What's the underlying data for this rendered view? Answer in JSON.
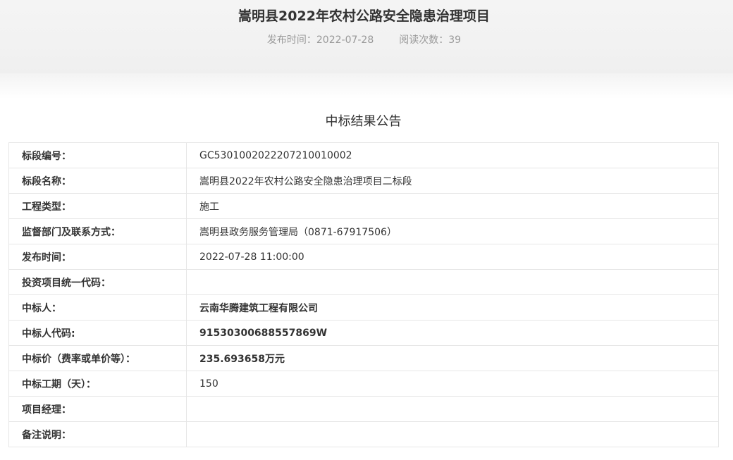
{
  "header": {
    "title": "嵩明县2022年农村公路安全隐患治理项目",
    "publish_label": "发布时间：2022-07-28",
    "read_label": "阅读次数：39"
  },
  "section_title": "中标结果公告",
  "rows": [
    {
      "label": "标段编号：",
      "value": "GC5301002022207210010002"
    },
    {
      "label": "标段名称：",
      "value": "嵩明县2022年农村公路安全隐患治理项目二标段"
    },
    {
      "label": "工程类型：",
      "value": "施工"
    },
    {
      "label": "监督部门及联系方式：",
      "value": "嵩明县政务服务管理局（0871-67917506）"
    },
    {
      "label": "发布时间：",
      "value": "2022-07-28 11:00:00"
    },
    {
      "label": "投资项目统一代码：",
      "value": ""
    },
    {
      "label": "中标人：",
      "value": "云南华腾建筑工程有限公司"
    },
    {
      "label": "中标人代码:",
      "value": "91530300688557869W"
    },
    {
      "label": "中标价（费率或单价等）：",
      "value": "235.693658万元"
    },
    {
      "label": "中标工期（天）：",
      "value": "150"
    },
    {
      "label": "项目经理：",
      "value": ""
    },
    {
      "label": "备注说明：",
      "value": ""
    }
  ]
}
